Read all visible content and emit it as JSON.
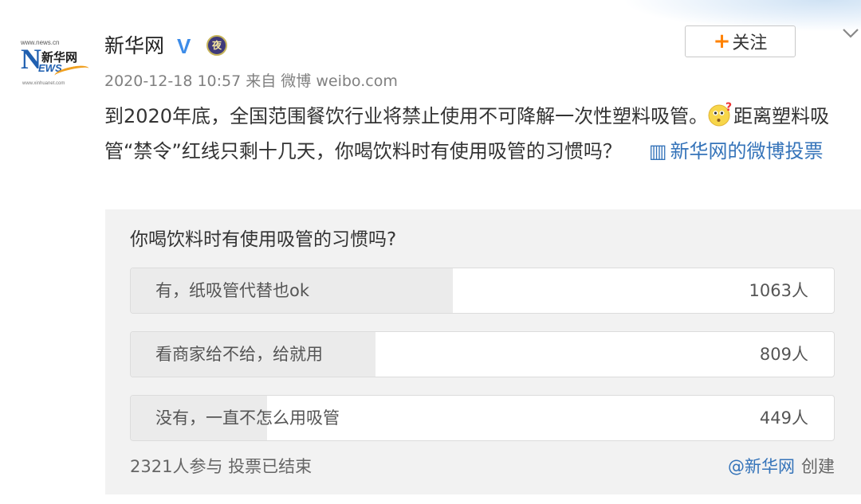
{
  "header": {
    "account_name": "新华网",
    "verified_mark": "V",
    "night_badge": "夜",
    "follow_label": "关注",
    "timestamp": "2020-12-18 10:57",
    "source": "来自 微博 weibo.com"
  },
  "avatar": {
    "url_top": "www.news.cn",
    "logo_letter": "N",
    "logo_cn": "新华网",
    "logo_ews": "EWS",
    "url_bottom": "www.xinhuanet.com"
  },
  "post": {
    "text_part1": "到2020年底，全国范围餐饮行业将禁止使用不可降解一次性塑料吸管。",
    "text_part2": "距离塑料吸管“禁令”红线只剩十几天，你喝饮料时有使用吸管的习惯吗？",
    "vote_link": "新华网的微博投票"
  },
  "poll": {
    "question": "你喝饮料时有使用吸管的习惯吗?",
    "options": [
      {
        "label": "有，纸吸管代替也ok",
        "count": "1063人",
        "votes": 1063
      },
      {
        "label": "看商家给不给，给就用",
        "count": "809人",
        "votes": 809
      },
      {
        "label": "没有，一直不怎么用吸管",
        "count": "449人",
        "votes": 449
      }
    ],
    "total_votes": 2321,
    "participants": "2321人参与 投票已结束",
    "creator": "@新华网",
    "created_label": "创建"
  },
  "colors": {
    "link": "#3473b9",
    "follow_plus": "#ff8200",
    "verified": "#3d8ce8",
    "poll_bg": "#f2f2f2",
    "bar_fill": "#ebebeb"
  }
}
